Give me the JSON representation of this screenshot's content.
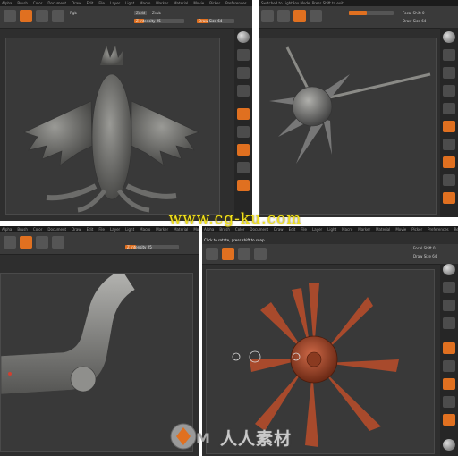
{
  "panels": {
    "p1": {
      "menu": [
        "Alpha",
        "Brush",
        "Color",
        "Document",
        "Draw",
        "Edit",
        "File",
        "Layer",
        "Light",
        "Macro",
        "Marker",
        "Material",
        "Movie",
        "Picker",
        "Preferences",
        "Render",
        "Stencil",
        "Stroke",
        "Texture",
        "Tool",
        "Transform",
        "Zplugin"
      ],
      "rgb_label": "Rgb",
      "zadd_label": "Zadd",
      "zsub_label": "Zsub",
      "intensity": "Z Intensity 25",
      "draw_size": "Draw Size 64",
      "focal_shift": "Focal Shift 0"
    },
    "p2": {
      "status": "Switched to LightBox Mode. Press Shift to exit.",
      "draw_size": "Draw Size 64",
      "focal_shift": "Focal Shift 0"
    },
    "p3": {
      "menu": [
        "Alpha",
        "Brush",
        "Color",
        "Document",
        "Draw",
        "Edit",
        "File",
        "Layer",
        "Light",
        "Macro",
        "Marker",
        "Material",
        "Movie",
        "Picker",
        "Preferences",
        "Render",
        "Stencil",
        "Stroke"
      ],
      "intensity": "Z Intensity 25"
    },
    "p4": {
      "hint": "Click to rotate, press shift to snap.",
      "menu": [
        "Alpha",
        "Brush",
        "Color",
        "Document",
        "Draw",
        "Edit",
        "File",
        "Layer",
        "Light",
        "Macro",
        "Marker",
        "Material",
        "Movie",
        "Picker",
        "Preferences",
        "Render",
        "Stencil",
        "Stroke",
        "Texture",
        "Tool",
        "Transform",
        "Zplugin"
      ],
      "draw_size": "Draw Size 64",
      "focal_shift": "Focal Shift 0"
    },
    "sidebar_labels": [
      "BPR",
      "SPix",
      "Scroll",
      "Zoom",
      "Actual",
      "AAHalf",
      "Persp",
      "Floor",
      "Local",
      "Frame",
      "Move",
      "Scale",
      "Rotate",
      "PolyF",
      "Transp",
      "Solo"
    ]
  },
  "watermarks": {
    "site": "www.cg-ku.com",
    "cn": "人人素材"
  },
  "colors": {
    "accent": "#e07020",
    "ui_bg": "#2e2e2e",
    "model_gray": "#7a7a78",
    "model_red": "#a84a2c",
    "watermark_yellow": "#f2e21a"
  }
}
